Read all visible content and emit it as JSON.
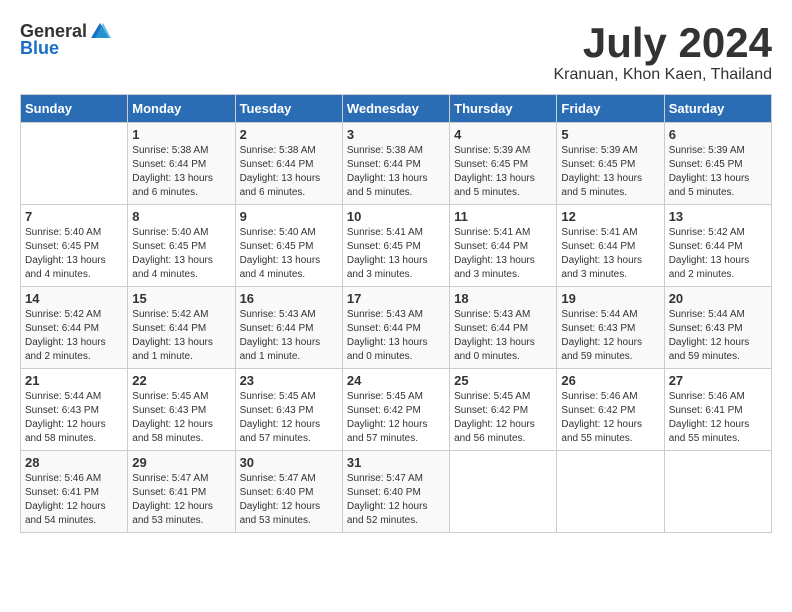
{
  "header": {
    "logo_general": "General",
    "logo_blue": "Blue",
    "month_year": "July 2024",
    "location": "Kranuan, Khon Kaen, Thailand"
  },
  "weekdays": [
    "Sunday",
    "Monday",
    "Tuesday",
    "Wednesday",
    "Thursday",
    "Friday",
    "Saturday"
  ],
  "weeks": [
    [
      {
        "day": "",
        "info": ""
      },
      {
        "day": "1",
        "info": "Sunrise: 5:38 AM\nSunset: 6:44 PM\nDaylight: 13 hours\nand 6 minutes."
      },
      {
        "day": "2",
        "info": "Sunrise: 5:38 AM\nSunset: 6:44 PM\nDaylight: 13 hours\nand 6 minutes."
      },
      {
        "day": "3",
        "info": "Sunrise: 5:38 AM\nSunset: 6:44 PM\nDaylight: 13 hours\nand 5 minutes."
      },
      {
        "day": "4",
        "info": "Sunrise: 5:39 AM\nSunset: 6:45 PM\nDaylight: 13 hours\nand 5 minutes."
      },
      {
        "day": "5",
        "info": "Sunrise: 5:39 AM\nSunset: 6:45 PM\nDaylight: 13 hours\nand 5 minutes."
      },
      {
        "day": "6",
        "info": "Sunrise: 5:39 AM\nSunset: 6:45 PM\nDaylight: 13 hours\nand 5 minutes."
      }
    ],
    [
      {
        "day": "7",
        "info": "Sunrise: 5:40 AM\nSunset: 6:45 PM\nDaylight: 13 hours\nand 4 minutes."
      },
      {
        "day": "8",
        "info": "Sunrise: 5:40 AM\nSunset: 6:45 PM\nDaylight: 13 hours\nand 4 minutes."
      },
      {
        "day": "9",
        "info": "Sunrise: 5:40 AM\nSunset: 6:45 PM\nDaylight: 13 hours\nand 4 minutes."
      },
      {
        "day": "10",
        "info": "Sunrise: 5:41 AM\nSunset: 6:45 PM\nDaylight: 13 hours\nand 3 minutes."
      },
      {
        "day": "11",
        "info": "Sunrise: 5:41 AM\nSunset: 6:44 PM\nDaylight: 13 hours\nand 3 minutes."
      },
      {
        "day": "12",
        "info": "Sunrise: 5:41 AM\nSunset: 6:44 PM\nDaylight: 13 hours\nand 3 minutes."
      },
      {
        "day": "13",
        "info": "Sunrise: 5:42 AM\nSunset: 6:44 PM\nDaylight: 13 hours\nand 2 minutes."
      }
    ],
    [
      {
        "day": "14",
        "info": "Sunrise: 5:42 AM\nSunset: 6:44 PM\nDaylight: 13 hours\nand 2 minutes."
      },
      {
        "day": "15",
        "info": "Sunrise: 5:42 AM\nSunset: 6:44 PM\nDaylight: 13 hours\nand 1 minute."
      },
      {
        "day": "16",
        "info": "Sunrise: 5:43 AM\nSunset: 6:44 PM\nDaylight: 13 hours\nand 1 minute."
      },
      {
        "day": "17",
        "info": "Sunrise: 5:43 AM\nSunset: 6:44 PM\nDaylight: 13 hours\nand 0 minutes."
      },
      {
        "day": "18",
        "info": "Sunrise: 5:43 AM\nSunset: 6:44 PM\nDaylight: 13 hours\nand 0 minutes."
      },
      {
        "day": "19",
        "info": "Sunrise: 5:44 AM\nSunset: 6:43 PM\nDaylight: 12 hours\nand 59 minutes."
      },
      {
        "day": "20",
        "info": "Sunrise: 5:44 AM\nSunset: 6:43 PM\nDaylight: 12 hours\nand 59 minutes."
      }
    ],
    [
      {
        "day": "21",
        "info": "Sunrise: 5:44 AM\nSunset: 6:43 PM\nDaylight: 12 hours\nand 58 minutes."
      },
      {
        "day": "22",
        "info": "Sunrise: 5:45 AM\nSunset: 6:43 PM\nDaylight: 12 hours\nand 58 minutes."
      },
      {
        "day": "23",
        "info": "Sunrise: 5:45 AM\nSunset: 6:43 PM\nDaylight: 12 hours\nand 57 minutes."
      },
      {
        "day": "24",
        "info": "Sunrise: 5:45 AM\nSunset: 6:42 PM\nDaylight: 12 hours\nand 57 minutes."
      },
      {
        "day": "25",
        "info": "Sunrise: 5:45 AM\nSunset: 6:42 PM\nDaylight: 12 hours\nand 56 minutes."
      },
      {
        "day": "26",
        "info": "Sunrise: 5:46 AM\nSunset: 6:42 PM\nDaylight: 12 hours\nand 55 minutes."
      },
      {
        "day": "27",
        "info": "Sunrise: 5:46 AM\nSunset: 6:41 PM\nDaylight: 12 hours\nand 55 minutes."
      }
    ],
    [
      {
        "day": "28",
        "info": "Sunrise: 5:46 AM\nSunset: 6:41 PM\nDaylight: 12 hours\nand 54 minutes."
      },
      {
        "day": "29",
        "info": "Sunrise: 5:47 AM\nSunset: 6:41 PM\nDaylight: 12 hours\nand 53 minutes."
      },
      {
        "day": "30",
        "info": "Sunrise: 5:47 AM\nSunset: 6:40 PM\nDaylight: 12 hours\nand 53 minutes."
      },
      {
        "day": "31",
        "info": "Sunrise: 5:47 AM\nSunset: 6:40 PM\nDaylight: 12 hours\nand 52 minutes."
      },
      {
        "day": "",
        "info": ""
      },
      {
        "day": "",
        "info": ""
      },
      {
        "day": "",
        "info": ""
      }
    ]
  ]
}
